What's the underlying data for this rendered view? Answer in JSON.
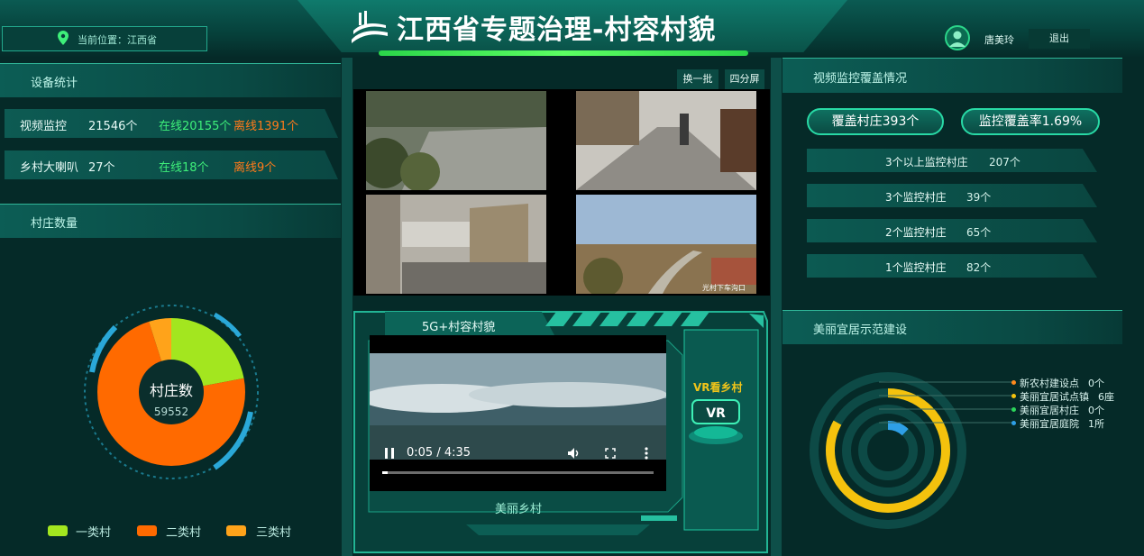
{
  "header": {
    "title": "江西省专题治理-村容村貌",
    "location": "当前位置：江西省",
    "username": "唐美玲",
    "logout": "退出"
  },
  "device_stats": {
    "title": "设备统计",
    "rows": [
      {
        "name": "视频监控",
        "count": "21546个",
        "online": "在线20155个",
        "offline": "离线1391个"
      },
      {
        "name": "乡村大喇叭",
        "count": "27个",
        "online": "在线18个",
        "offline": "离线9个"
      }
    ]
  },
  "village_count": {
    "title": "村庄数量",
    "center_label": "村庄数",
    "center_value": "59552",
    "legend": [
      {
        "label": "一类村",
        "color": "#a3e61f"
      },
      {
        "label": "二类村",
        "color": "#ff6a00"
      },
      {
        "label": "三类村",
        "color": "#ffa31a"
      }
    ]
  },
  "chart_data": {
    "type": "pie",
    "title": "村庄数",
    "categories": [
      "一类村",
      "二类村",
      "三类村"
    ],
    "values": [
      0.22,
      0.73,
      0.05
    ],
    "total": 59552,
    "colors": [
      "#a3e61f",
      "#ff6a00",
      "#ffa31a"
    ]
  },
  "video_grid": {
    "refresh_button": "换一批",
    "split_button": "四分屏",
    "cam_caption": "光村下车沟口"
  },
  "vr_panel": {
    "title": "5G+村容村貌",
    "time": "0:05 / 4:35",
    "progress": 0.02,
    "caption": "美丽乡村",
    "vr_label": "VR看乡村",
    "vr_icon_text": "VR"
  },
  "coverage": {
    "title": "视频监控覆盖情况",
    "pill_left": "覆盖村庄393个",
    "pill_right": "监控覆盖率1.69%",
    "rows": [
      {
        "label": "3个以上监控村庄",
        "value": "207个"
      },
      {
        "label": "3个监控村庄",
        "value": "39个"
      },
      {
        "label": "2个监控村庄",
        "value": "65个"
      },
      {
        "label": "1个监控村庄",
        "value": "82个"
      }
    ]
  },
  "beautiful": {
    "title": "美丽宜居示范建设",
    "legend": [
      {
        "label": "新农村建设点",
        "value": "0个",
        "color": "#ff8a1c"
      },
      {
        "label": "美丽宜居试点镇",
        "value": "6座",
        "color": "#f4c20d"
      },
      {
        "label": "美丽宜居村庄",
        "value": "0个",
        "color": "#2bd65a"
      },
      {
        "label": "美丽宜居庭院",
        "value": "1所",
        "color": "#2e9fe6"
      }
    ],
    "rings": [
      0.0,
      0.83,
      0.0,
      0.12
    ]
  }
}
